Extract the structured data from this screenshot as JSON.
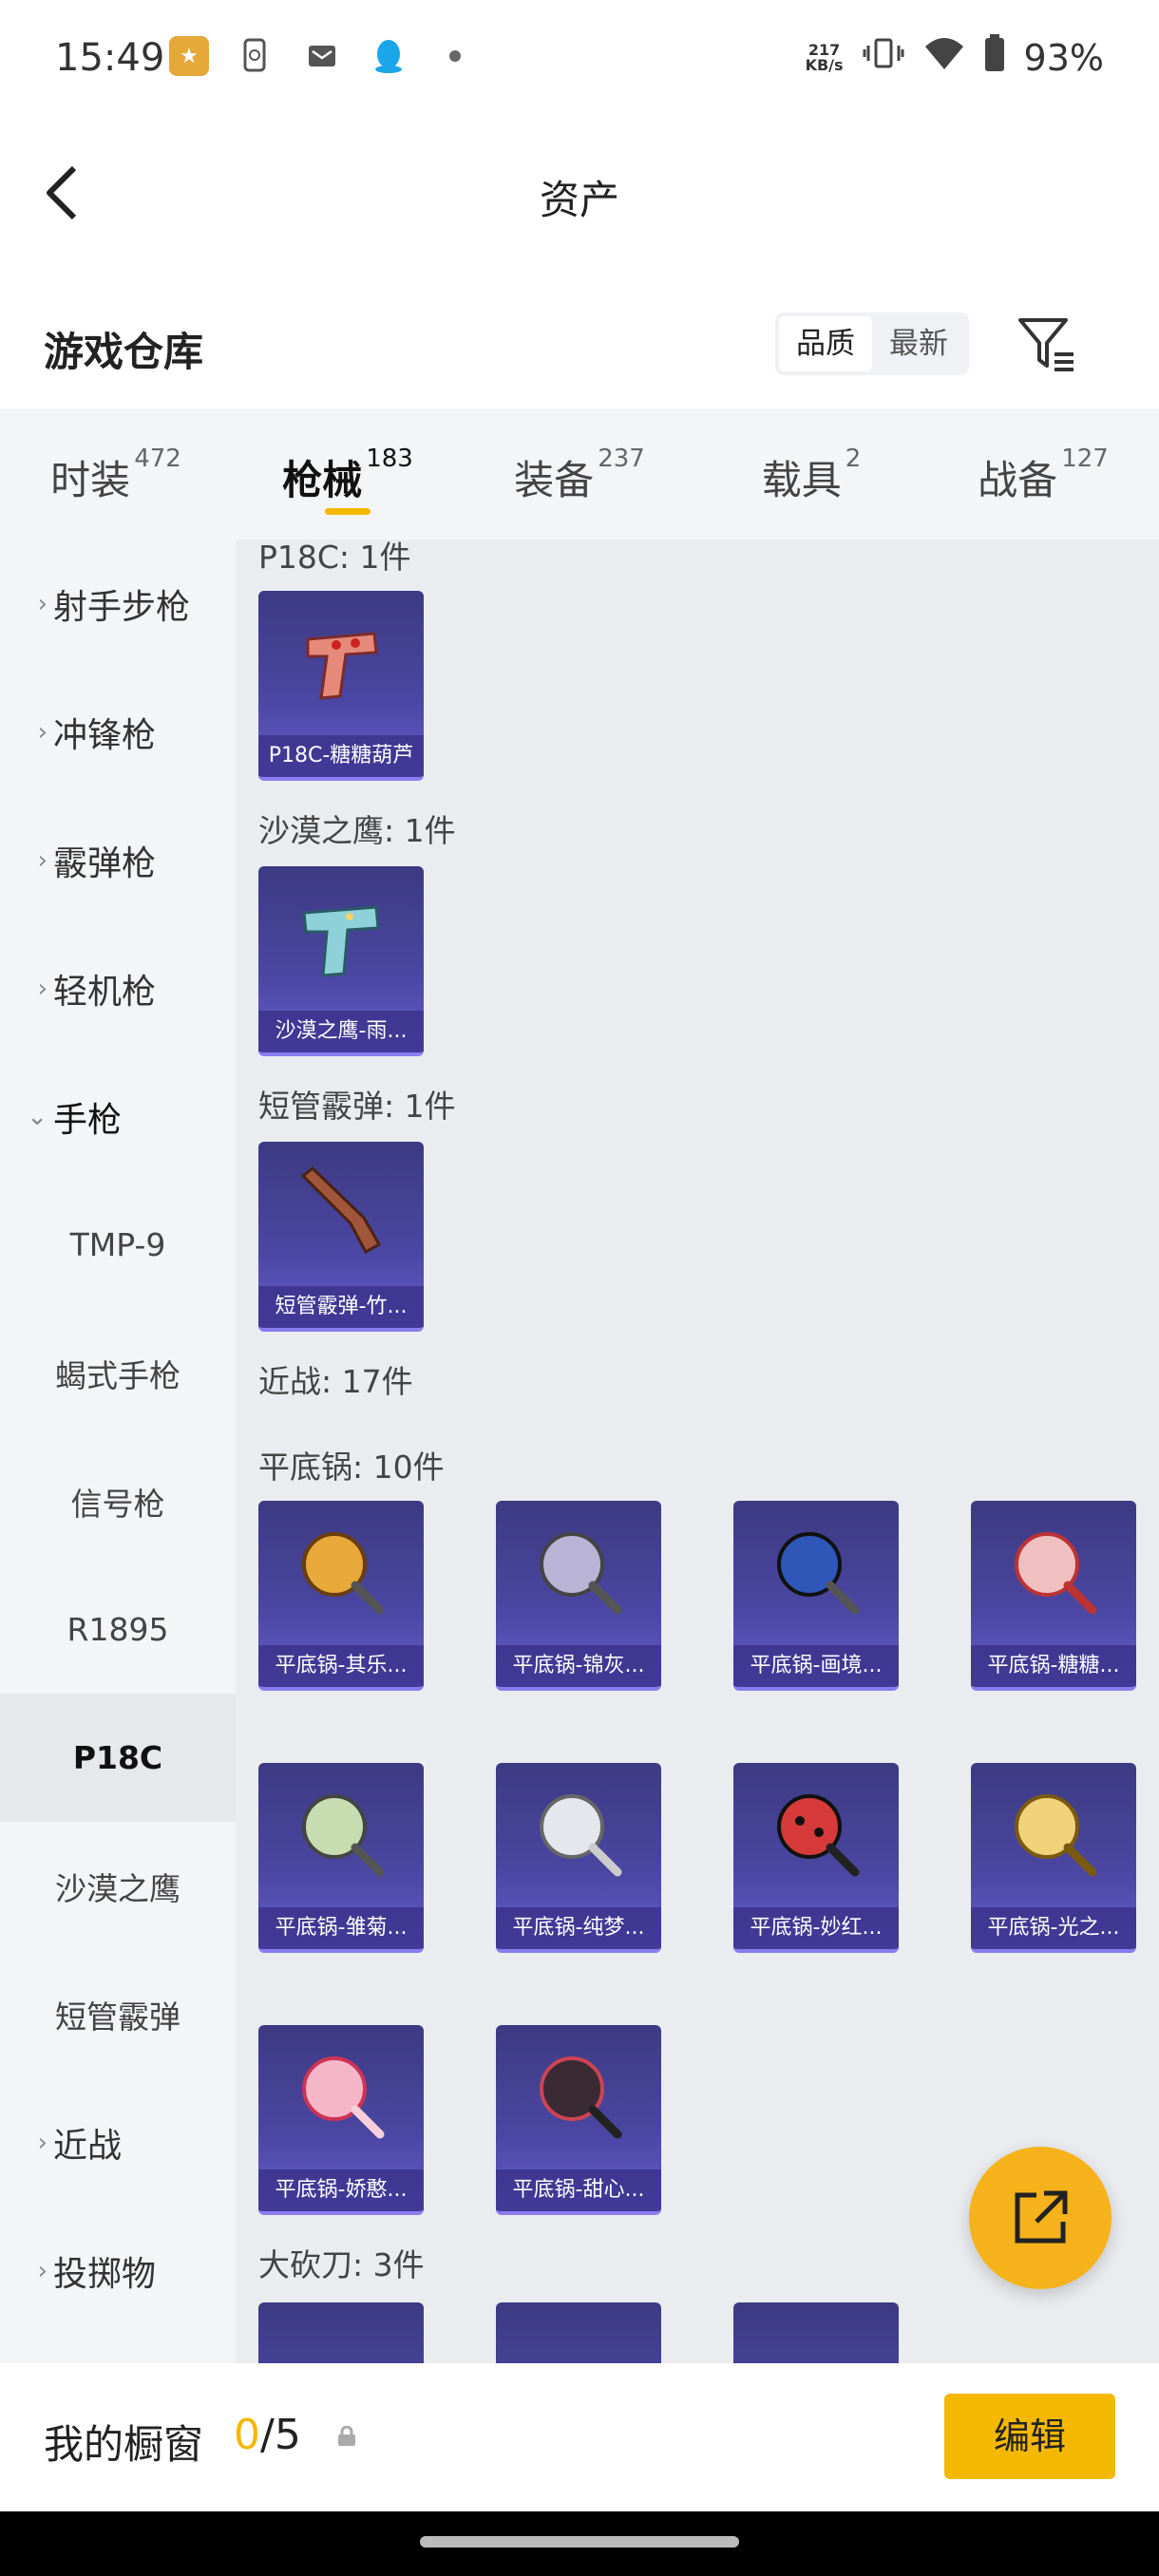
{
  "status_bar": {
    "time": "15:49",
    "net_speed_value": "217",
    "net_speed_unit": "KB/s",
    "battery": "93%",
    "app_icons": [
      "game-app-icon",
      "phone-sync-icon",
      "mail-icon",
      "qq-icon",
      "dot-icon"
    ]
  },
  "header": {
    "title": "资产",
    "back_icon": "chevron-left-icon"
  },
  "warehouse": {
    "title": "游戏仓库",
    "sort_options": [
      "品质",
      "最新"
    ],
    "selected_sort": "品质",
    "filter_icon": "filter-icon"
  },
  "tabs": [
    {
      "label": "时装",
      "count": "472",
      "active": false
    },
    {
      "label": "枪械",
      "count": "183",
      "active": true
    },
    {
      "label": "装备",
      "count": "237",
      "active": false
    },
    {
      "label": "载具",
      "count": "2",
      "active": false
    },
    {
      "label": "战备",
      "count": "127",
      "active": false
    }
  ],
  "sidebar": {
    "items": [
      {
        "label": "射手步枪",
        "type": "category",
        "expanded": false
      },
      {
        "label": "冲锋枪",
        "type": "category",
        "expanded": false
      },
      {
        "label": "霰弹枪",
        "type": "category",
        "expanded": false
      },
      {
        "label": "轻机枪",
        "type": "category",
        "expanded": false
      },
      {
        "label": "手枪",
        "type": "category",
        "expanded": true
      },
      {
        "label": "TMP-9",
        "type": "sub"
      },
      {
        "label": "蝎式手枪",
        "type": "sub"
      },
      {
        "label": "信号枪",
        "type": "sub"
      },
      {
        "label": "R1895",
        "type": "sub"
      },
      {
        "label": "P18C",
        "type": "sub",
        "selected": true
      },
      {
        "label": "沙漠之鹰",
        "type": "sub"
      },
      {
        "label": "短管霰弹",
        "type": "sub"
      },
      {
        "label": "近战",
        "type": "category",
        "expanded": false
      },
      {
        "label": "投掷物",
        "type": "category",
        "expanded": false
      }
    ]
  },
  "content": {
    "groups": [
      {
        "title": "P18C: 1件",
        "items": [
          "P18C-糖糖葫芦"
        ]
      },
      {
        "title": "沙漠之鹰: 1件",
        "items": [
          "沙漠之鹰-雨..."
        ]
      },
      {
        "title": "短管霰弹: 1件",
        "items": [
          "短管霰弹-竹..."
        ]
      },
      {
        "title": "近战: 17件",
        "items": []
      },
      {
        "title": "平底锅: 10件",
        "items": [
          "平底锅-其乐...",
          "平底锅-锦灰...",
          "平底锅-画境...",
          "平底锅-糖糖...",
          "平底锅-雏菊...",
          "平底锅-纯梦...",
          "平底锅-妙红...",
          "平底锅-光之...",
          "平底锅-娇憨...",
          "平底锅-甜心..."
        ]
      },
      {
        "title": "大砍刀: 3件",
        "items": [
          "",
          "",
          ""
        ]
      }
    ]
  },
  "bottom_bar": {
    "label": "我的橱窗",
    "current": "0",
    "total": "/5",
    "edit_label": "编辑"
  },
  "colors": {
    "accent": "#f5b800",
    "card_bg": "#4b47a3",
    "sidebar_bg": "#f4f5f7",
    "content_bg": "#eaecf0"
  }
}
